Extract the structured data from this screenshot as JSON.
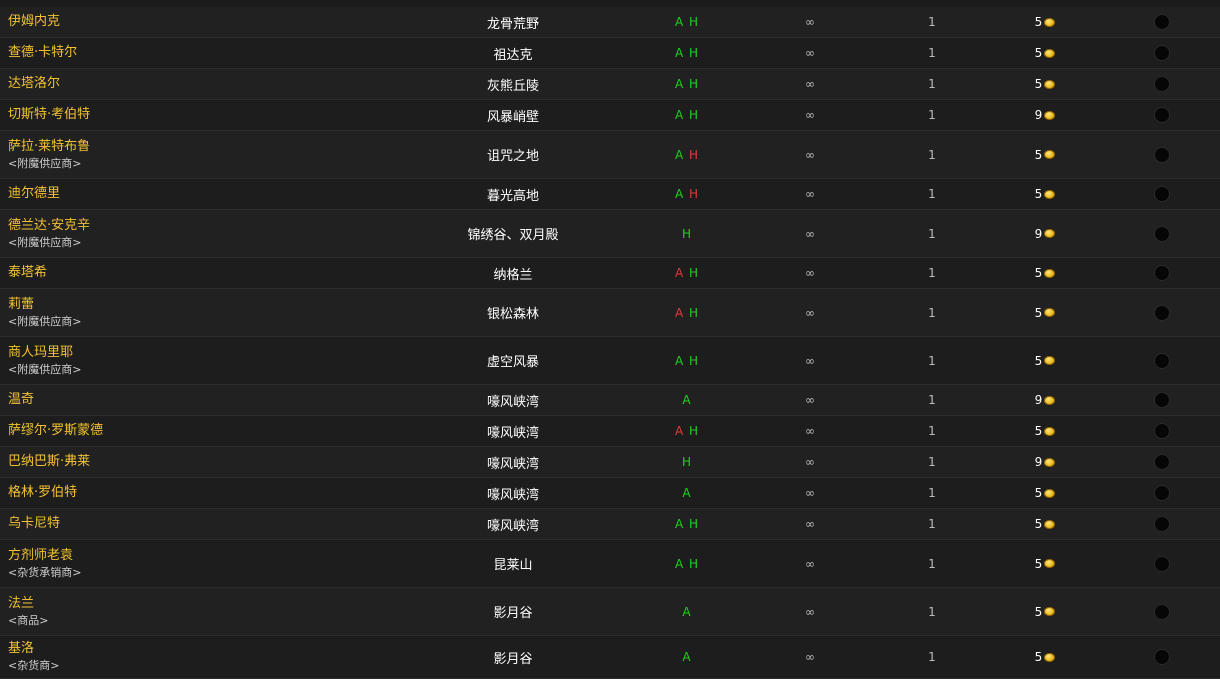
{
  "rows": [
    {
      "name": "伊姆内克",
      "sub": "",
      "zone": "龙骨荒野",
      "faction": [
        {
          "t": "A",
          "c": "g"
        },
        {
          "t": "H",
          "c": "g"
        }
      ],
      "stock": "∞",
      "qty": "1",
      "cost": "5"
    },
    {
      "name": "查德·卡特尔",
      "sub": "",
      "zone": "祖达克",
      "faction": [
        {
          "t": "A",
          "c": "g"
        },
        {
          "t": "H",
          "c": "g"
        }
      ],
      "stock": "∞",
      "qty": "1",
      "cost": "5"
    },
    {
      "name": "达塔洛尔",
      "sub": "",
      "zone": "灰熊丘陵",
      "faction": [
        {
          "t": "A",
          "c": "g"
        },
        {
          "t": "H",
          "c": "g"
        }
      ],
      "stock": "∞",
      "qty": "1",
      "cost": "5"
    },
    {
      "name": "切斯特·考伯特",
      "sub": "",
      "zone": "风暴峭壁",
      "faction": [
        {
          "t": "A",
          "c": "g"
        },
        {
          "t": "H",
          "c": "g"
        }
      ],
      "stock": "∞",
      "qty": "1",
      "cost": "9"
    },
    {
      "name": "萨拉·莱特布鲁",
      "sub": "<附魔供应商>",
      "zone": "诅咒之地",
      "faction": [
        {
          "t": "A",
          "c": "g"
        },
        {
          "t": "H",
          "c": "r"
        }
      ],
      "stock": "∞",
      "qty": "1",
      "cost": "5"
    },
    {
      "name": "迪尔德里",
      "sub": "",
      "zone": "暮光高地",
      "faction": [
        {
          "t": "A",
          "c": "g"
        },
        {
          "t": "H",
          "c": "r"
        }
      ],
      "stock": "∞",
      "qty": "1",
      "cost": "5"
    },
    {
      "name": "德兰达·安克辛",
      "sub": "<附魔供应商>",
      "zone": "锦绣谷、双月殿",
      "faction": [
        {
          "t": "H",
          "c": "g"
        }
      ],
      "stock": "∞",
      "qty": "1",
      "cost": "9"
    },
    {
      "name": "泰塔希",
      "sub": "",
      "zone": "纳格兰",
      "faction": [
        {
          "t": "A",
          "c": "r"
        },
        {
          "t": "H",
          "c": "g"
        }
      ],
      "stock": "∞",
      "qty": "1",
      "cost": "5"
    },
    {
      "name": "莉蕾",
      "sub": "<附魔供应商>",
      "zone": "银松森林",
      "faction": [
        {
          "t": "A",
          "c": "r"
        },
        {
          "t": "H",
          "c": "g"
        }
      ],
      "stock": "∞",
      "qty": "1",
      "cost": "5"
    },
    {
      "name": "商人玛里耶",
      "sub": "<附魔供应商>",
      "zone": "虚空风暴",
      "faction": [
        {
          "t": "A",
          "c": "g"
        },
        {
          "t": "H",
          "c": "g"
        }
      ],
      "stock": "∞",
      "qty": "1",
      "cost": "5"
    },
    {
      "name": "温奇",
      "sub": "",
      "zone": "嚎风峡湾",
      "faction": [
        {
          "t": "A",
          "c": "g"
        }
      ],
      "stock": "∞",
      "qty": "1",
      "cost": "9"
    },
    {
      "name": "萨缪尔·罗斯蒙德",
      "sub": "",
      "zone": "嚎风峡湾",
      "faction": [
        {
          "t": "A",
          "c": "r"
        },
        {
          "t": "H",
          "c": "g"
        }
      ],
      "stock": "∞",
      "qty": "1",
      "cost": "5"
    },
    {
      "name": "巴纳巴斯·弗莱",
      "sub": "",
      "zone": "嚎风峡湾",
      "faction": [
        {
          "t": "H",
          "c": "g"
        }
      ],
      "stock": "∞",
      "qty": "1",
      "cost": "9"
    },
    {
      "name": "格林·罗伯特",
      "sub": "",
      "zone": "嚎风峡湾",
      "faction": [
        {
          "t": "A",
          "c": "g"
        }
      ],
      "stock": "∞",
      "qty": "1",
      "cost": "5"
    },
    {
      "name": "乌卡尼特",
      "sub": "",
      "zone": "嚎风峡湾",
      "faction": [
        {
          "t": "A",
          "c": "g"
        },
        {
          "t": "H",
          "c": "g"
        }
      ],
      "stock": "∞",
      "qty": "1",
      "cost": "5"
    },
    {
      "name": "方剂师老袁",
      "sub": "<杂货承销商>",
      "zone": "昆莱山",
      "faction": [
        {
          "t": "A",
          "c": "g"
        },
        {
          "t": "H",
          "c": "g"
        }
      ],
      "stock": "∞",
      "qty": "1",
      "cost": "5"
    },
    {
      "name": "法兰",
      "sub": "<商品>",
      "zone": "影月谷",
      "faction": [
        {
          "t": "A",
          "c": "g"
        }
      ],
      "stock": "∞",
      "qty": "1",
      "cost": "5"
    },
    {
      "name": "基洛",
      "sub": "<杂货商>",
      "zone": "影月谷",
      "faction": [
        {
          "t": "A",
          "c": "g"
        }
      ],
      "stock": "∞",
      "qty": "1",
      "cost": "5"
    }
  ],
  "colors": {
    "name": "#f2c230",
    "green": "#1fd11f",
    "red": "#e03a3a"
  }
}
